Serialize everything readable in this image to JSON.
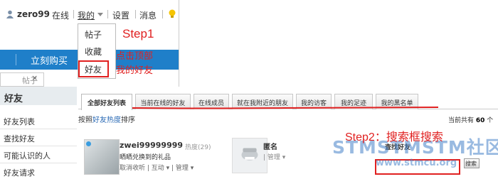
{
  "topbar": {
    "username": "zero99",
    "online_status": "在线",
    "my_menu": "我的",
    "settings": "设置",
    "messages": "消息"
  },
  "dropdown": {
    "items": [
      "帖子",
      "收藏",
      "好友"
    ],
    "highlighted": "好友"
  },
  "nav": {
    "buy_now": "立刻购买"
  },
  "sub_input": {
    "text": "帖子",
    "close": "×"
  },
  "annotations": {
    "step1": "Step1",
    "step1_note_line1": "点击顶部",
    "step1_note_line2": "我的好友",
    "step2": "Step2：搜索框搜索",
    "highlight_color": "#e02020"
  },
  "sidebar": {
    "title": "好友",
    "items": [
      "好友列表",
      "查找好友",
      "可能认识的人",
      "好友请求"
    ]
  },
  "tabs": [
    "全部好友列表",
    "当前在线的好友",
    "在线成员",
    "就在我附近的朋友",
    "我的访客",
    "我的足迹",
    "我的黑名单"
  ],
  "sort": {
    "prefix": "按照",
    "link": "好友热度",
    "suffix": "排序"
  },
  "total": {
    "prefix": "当前共有",
    "count": "60",
    "suffix": "个"
  },
  "friend_card": {
    "username": "zwei99999999",
    "heat": "热度(29)",
    "status": "晒晒兑换到的礼品",
    "actions": "取消收听 | 互动 ▾ | 管理 ▾"
  },
  "anon_card": {
    "name": "匿名",
    "manage": "| 管理 ▾"
  },
  "find_box": {
    "title": "查找好友",
    "button": "搜索"
  },
  "watermark": {
    "text": "STMSTMSTM社区",
    "sub": "www.stmcu.org"
  }
}
